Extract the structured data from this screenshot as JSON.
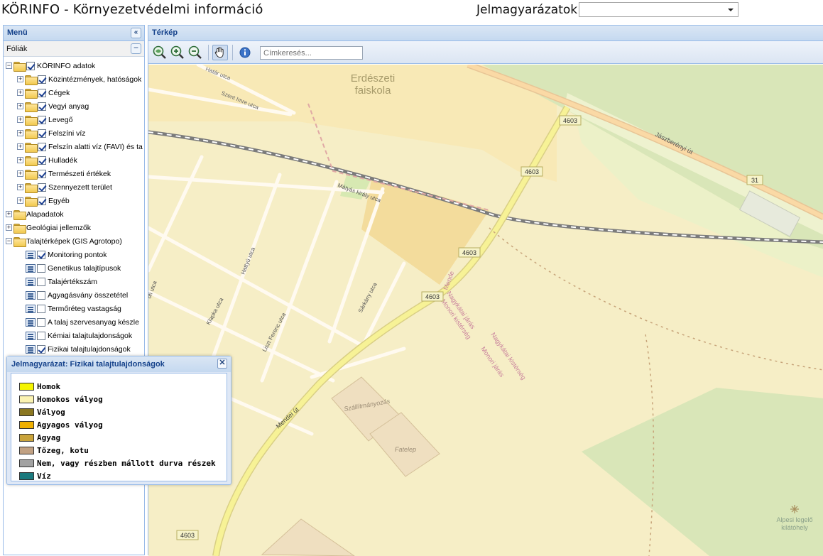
{
  "header": {
    "title": "KÖRINFO - Környezetvédelmi információ",
    "legend_label": "Jelmagyarázatok:",
    "legend_select_value": ""
  },
  "menu": {
    "title": "Menü",
    "collapse_icon": "double-chevron-left-icon",
    "layers_title": "Fóliák",
    "tree": [
      {
        "label": "KÖRINFO adatok",
        "level": 0,
        "expander": "−",
        "icon": "folder",
        "checked": true
      },
      {
        "label": "Közintézmények, hatóságok",
        "level": 1,
        "expander": "+",
        "icon": "folder",
        "checked": true
      },
      {
        "label": "Cégek",
        "level": 1,
        "expander": "+",
        "icon": "folder",
        "checked": true
      },
      {
        "label": "Vegyi anyag",
        "level": 1,
        "expander": "+",
        "icon": "folder",
        "checked": true
      },
      {
        "label": "Levegő",
        "level": 1,
        "expander": "+",
        "icon": "folder",
        "checked": true
      },
      {
        "label": "Felszíni víz",
        "level": 1,
        "expander": "+",
        "icon": "folder",
        "checked": true
      },
      {
        "label": "Felszín alatti víz (FAVI) és ta",
        "level": 1,
        "expander": "+",
        "icon": "folder",
        "checked": true
      },
      {
        "label": "Hulladék",
        "level": 1,
        "expander": "+",
        "icon": "folder",
        "checked": true
      },
      {
        "label": "Természeti értékek",
        "level": 1,
        "expander": "+",
        "icon": "folder",
        "checked": true
      },
      {
        "label": "Szennyezett terület",
        "level": 1,
        "expander": "+",
        "icon": "folder",
        "checked": true
      },
      {
        "label": "Egyéb",
        "level": 1,
        "expander": "+",
        "icon": "folder",
        "checked": true
      },
      {
        "label": "Alapadatok",
        "level": 0,
        "expander": "+",
        "icon": "folder"
      },
      {
        "label": "Geológiai jellemzők",
        "level": 0,
        "expander": "+",
        "icon": "folder"
      },
      {
        "label": "Talajtérképek (GIS Agrotopo)",
        "level": 0,
        "expander": "−",
        "icon": "folder-open"
      },
      {
        "label": "Monitoring pontok",
        "level": 1,
        "icon": "legend",
        "checked": true
      },
      {
        "label": "Genetikus talajtípusok",
        "level": 1,
        "icon": "legend",
        "checked": false
      },
      {
        "label": "Talajértékszám",
        "level": 1,
        "icon": "legend",
        "checked": false
      },
      {
        "label": "Agyagásvány összetétel",
        "level": 1,
        "icon": "legend",
        "checked": false
      },
      {
        "label": "Termőréteg vastagság",
        "level": 1,
        "icon": "legend",
        "checked": false
      },
      {
        "label": "A talaj szervesanyag készle",
        "level": 1,
        "icon": "legend",
        "checked": false
      },
      {
        "label": "Kémiai talajtulajdonságok",
        "level": 1,
        "icon": "legend",
        "checked": false
      },
      {
        "label": "Fizikai talajtulajdonságok",
        "level": 1,
        "icon": "legend",
        "checked": true
      }
    ]
  },
  "map_panel": {
    "title": "Térkép",
    "tools": [
      {
        "name": "zoom-extent-icon"
      },
      {
        "name": "zoom-in-icon"
      },
      {
        "name": "zoom-out-icon"
      },
      {
        "name": "pan-hand-icon",
        "active": true
      },
      {
        "name": "info-icon"
      }
    ],
    "search_placeholder": "Címkeresés..."
  },
  "map": {
    "labels": {
      "erdeszeti_1": "Erdészeti",
      "erdeszeti_2": "faiskola",
      "hatar_utca": "Határ utca",
      "szent_imre": "Szent Imre utca",
      "jaszbereny": "Jászberényi út",
      "matyas": "Mátyás király utca",
      "road_4603": "4603",
      "road_31": "31",
      "hattyu": "Hattyú utca",
      "klapka": "Klapka utca",
      "liszt": "Liszt Ferenc utca",
      "sarkany": "Sárkány utca",
      "utca_left": "ófi utca",
      "mendei": "Mendei út",
      "mende": "Mende",
      "nagykatai_1": "Nagykátai járás",
      "monori_1": "Monori kistérség",
      "nagykatai_2": "Nagykátai kistérség",
      "monori_2": "Monori járás",
      "szallitmanyozas": "Szállítmányozás",
      "fatelep": "Fatelep",
      "alpesi_1": "Alpesi legelő",
      "alpesi_2": "kilátóhely"
    }
  },
  "legend_window": {
    "title": "Jelmagyarázat: Fizikai talajtulajdonságok",
    "close_icon": "close-icon",
    "items": [
      {
        "label": "Homok",
        "color": "#f5f500"
      },
      {
        "label": "Homokos vályog",
        "color": "#fbf3b2"
      },
      {
        "label": "Vályog",
        "color": "#8b7720"
      },
      {
        "label": "Agyagos vályog",
        "color": "#f0b000"
      },
      {
        "label": "Agyag",
        "color": "#c9a33a"
      },
      {
        "label": "Tőzeg, kotu",
        "color": "#c1a183"
      },
      {
        "label": "Nem, vagy részben mállott durva részek",
        "color": "#a2a2a2"
      },
      {
        "label": "Víz",
        "color": "#1b7a7e"
      }
    ]
  }
}
